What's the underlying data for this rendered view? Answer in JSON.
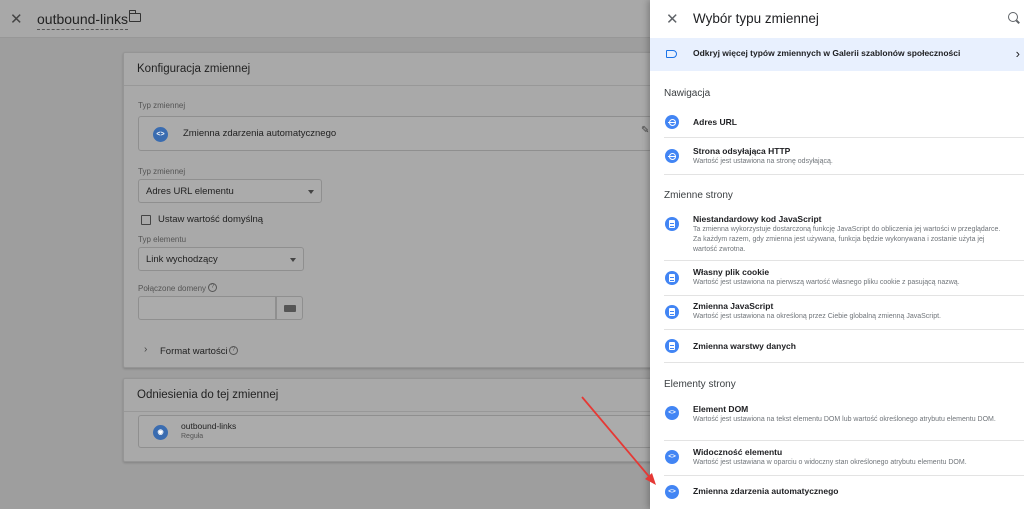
{
  "editor": {
    "title": "outbound-links",
    "config_card": {
      "header": "Konfiguracja zmiennej",
      "type_label": "Typ zmiennej",
      "type_value": "Zmienna zdarzenia automatycznego",
      "type_label2": "Typ zmiennej",
      "type_select": "Adres URL elementu",
      "default_checkbox": "Ustaw wartość domyślną",
      "element_type_label": "Typ elementu",
      "element_type_select": "Link wychodzący",
      "connected_domains_label": "Połączone domeny",
      "value_format": "Format wartości"
    },
    "refs_card": {
      "header": "Odniesienia do tej zmiennej",
      "ref_name": "outbound-links",
      "ref_type": "Reguła"
    }
  },
  "panel": {
    "title": "Wybór typu zmiennej",
    "promo": "Odkryj więcej typów zmiennych w Galerii szablonów społeczności",
    "sections": [
      {
        "title": "Nawigacja",
        "items": [
          {
            "icon": "globe-icon",
            "title": "Adres URL",
            "desc": ""
          },
          {
            "icon": "globe-icon",
            "title": "Strona odsyłająca HTTP",
            "desc": "Wartość jest ustawiona na stronę odsyłającą."
          }
        ]
      },
      {
        "title": "Zmienne strony",
        "items": [
          {
            "icon": "document-icon",
            "title": "Niestandardowy kod JavaScript",
            "desc": "Ta zmienna wykorzystuje dostarczoną funkcję JavaScript do obliczenia jej wartości w przeglądarce. Za każdym razem, gdy zmienna jest używana, funkcja będzie wykonywana i zostanie użyta jej wartość zwrotna."
          },
          {
            "icon": "document-icon",
            "title": "Własny plik cookie",
            "desc": "Wartość jest ustawiona na pierwszą wartość własnego pliku cookie z pasującą nazwą."
          },
          {
            "icon": "document-icon",
            "title": "Zmienna JavaScript",
            "desc": "Wartość jest ustawiona na określoną przez Ciebie globalną zmienną JavaScript."
          },
          {
            "icon": "document-icon",
            "title": "Zmienna warstwy danych",
            "desc": ""
          }
        ]
      },
      {
        "title": "Elementy strony",
        "items": [
          {
            "icon": "code-icon",
            "title": "Element DOM",
            "desc": "Wartość jest ustawiona na tekst elementu DOM lub wartość określonego atrybutu elementu DOM."
          },
          {
            "icon": "code-icon",
            "title": "Widoczność elementu",
            "desc": "Wartość jest ustawiana w oparciu o widoczny stan określonego atrybutu elementu DOM."
          },
          {
            "icon": "code-icon",
            "title": "Zmienna zdarzenia automatycznego",
            "desc": ""
          }
        ]
      }
    ]
  },
  "colors": {
    "accent": "#1a73e8",
    "icon_blue": "#4285f4",
    "annotation_arrow": "#e53935",
    "promo_bg": "#e8f0fe"
  }
}
